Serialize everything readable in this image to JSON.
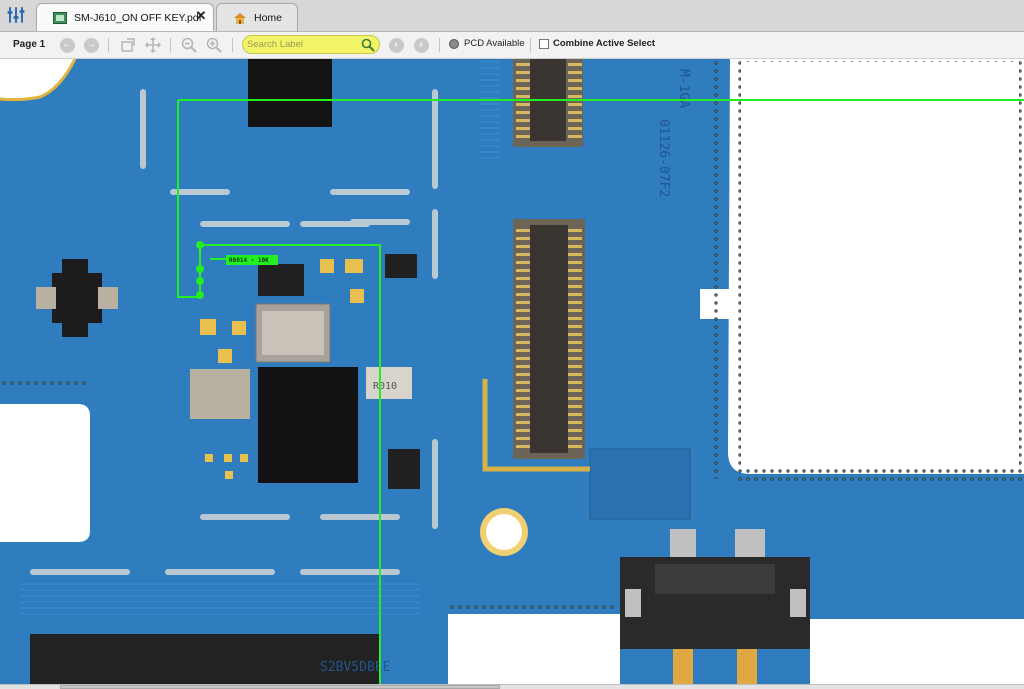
{
  "tabs": [
    {
      "label": "SM-J610_ON OFF KEY.pdf",
      "active": true,
      "icon": "pdf-document-icon"
    },
    {
      "label": "Home",
      "active": false,
      "icon": "home-icon"
    }
  ],
  "toolbar": {
    "page_label": "Page 1",
    "search_placeholder": "Search Label",
    "pcd_label": "PCD Available",
    "combine_label": "Combine Active Select",
    "combine_checked": false
  },
  "board": {
    "highlight_color": "#22ee22",
    "board_color": "#2f7dbf",
    "net_tag": "R6014 - 10K",
    "silkscreen": [
      "M-1GA",
      "01126-07F2",
      "R010",
      "S2BV5DBEE"
    ]
  }
}
